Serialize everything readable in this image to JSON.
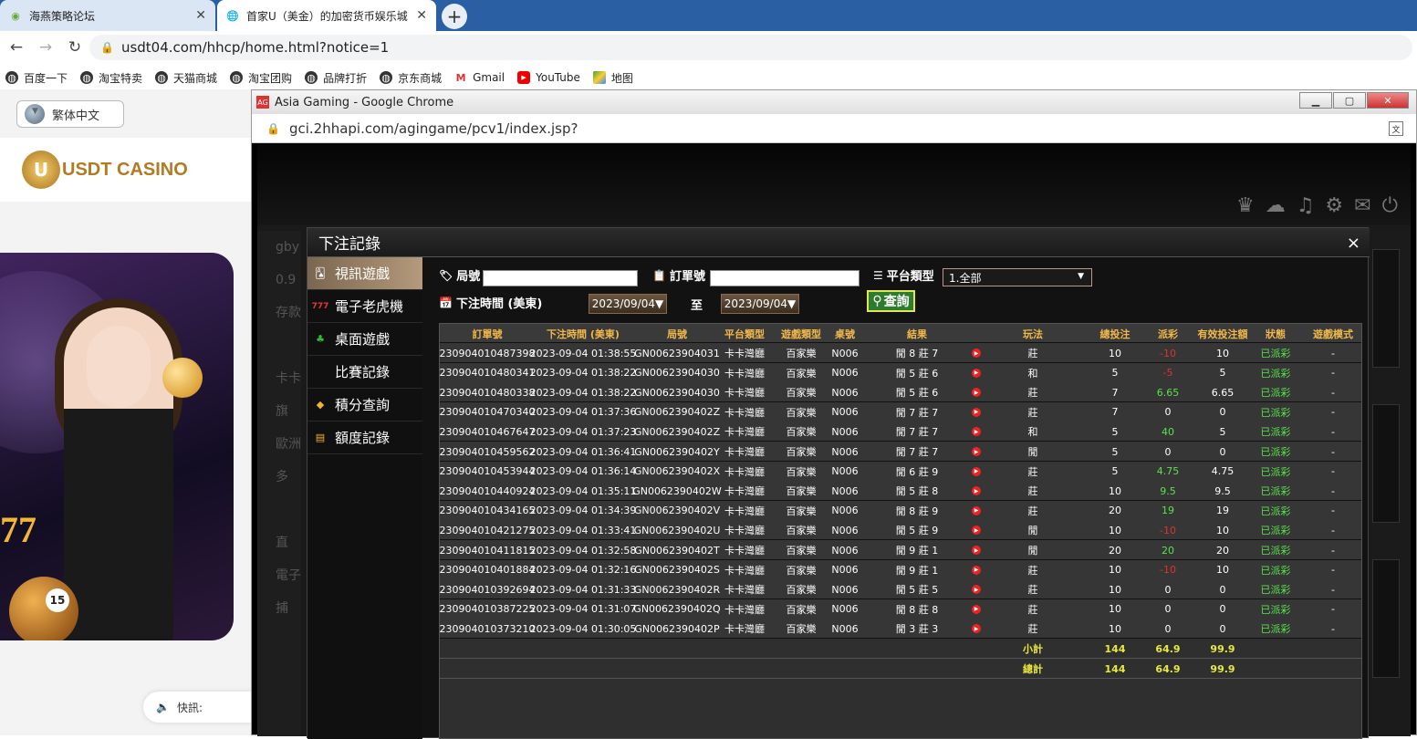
{
  "browser": {
    "tabs": [
      {
        "title": "海燕策略论坛"
      },
      {
        "title": "首家U（美金）的加密货币娱乐城"
      }
    ],
    "address": "usdt04.com/hhcp/home.html?notice=1",
    "bookmarks": [
      {
        "label": "百度一下",
        "icon": "globe-icon"
      },
      {
        "label": "淘宝特卖",
        "icon": "globe-icon"
      },
      {
        "label": "天猫商城",
        "icon": "globe-icon"
      },
      {
        "label": "淘宝团购",
        "icon": "globe-icon"
      },
      {
        "label": "品牌打折",
        "icon": "globe-icon"
      },
      {
        "label": "京东商城",
        "icon": "globe-icon"
      },
      {
        "label": "Gmail",
        "icon": "gmail-icon"
      },
      {
        "label": "YouTube",
        "icon": "youtube-icon"
      },
      {
        "label": "地图",
        "icon": "maps-icon"
      }
    ]
  },
  "site": {
    "language": "繁体中文",
    "logo_text": "USDT CASINO",
    "logo_letter": "U",
    "banner_number": "15",
    "banner_slot": "77",
    "chat_label": "快訊:"
  },
  "popup": {
    "title": "Asia Gaming - Google Chrome",
    "address": "gci.2hhapi.com/agingame/pcv1/index.jsp?"
  },
  "game": {
    "left_strip": [
      "gby",
      "0.9",
      "存款",
      "",
      "卡卡",
      "旗",
      "歐洲",
      "多",
      "",
      "直",
      "電子",
      "捕"
    ]
  },
  "modal": {
    "title": "下注記錄",
    "close": "×",
    "menu": [
      {
        "label": "視訊遊戲",
        "icon": "cards-icon",
        "active": true
      },
      {
        "label": "電子老虎機",
        "icon": "slot-777-icon",
        "active": false
      },
      {
        "label": "桌面遊戲",
        "icon": "table-game-icon",
        "active": false
      },
      {
        "label": "比賽記錄",
        "icon": "",
        "active": false
      },
      {
        "label": "積分查詢",
        "icon": "diamond-icon",
        "active": false
      },
      {
        "label": "額度記錄",
        "icon": "document-icon",
        "active": false
      }
    ],
    "filters": {
      "round_label": "局號",
      "order_label": "訂單號",
      "platform_label": "平台類型",
      "platform_value": "1.全部",
      "time_label": "下注時間 (美東)",
      "date_from": "2023/09/04▼",
      "to_label": "至",
      "date_to": "2023/09/04▼",
      "query_label": "查詢"
    },
    "table": {
      "headers": [
        "訂單號",
        "下注時間 (美東)",
        "局號",
        "平台類型",
        "遊戲類型",
        "桌號",
        "結果",
        "",
        "玩法",
        "總投注",
        "派彩",
        "有效投注額",
        "狀態",
        "遊戲模式"
      ],
      "rows": [
        [
          "230904010487398",
          "2023-09-04 01:38:55",
          "GN00623904031",
          "卡卡灣廳",
          "百家樂",
          "N006",
          "閒 8 莊 7",
          "莊",
          "10",
          "-10",
          "10",
          "已派彩",
          "-"
        ],
        [
          "230904010480341",
          "2023-09-04 01:38:22",
          "GN00623904030",
          "卡卡灣廳",
          "百家樂",
          "N006",
          "閒 5 莊 6",
          "和",
          "5",
          "-5",
          "5",
          "已派彩",
          "-"
        ],
        [
          "230904010480338",
          "2023-09-04 01:38:22",
          "GN00623904030",
          "卡卡灣廳",
          "百家樂",
          "N006",
          "閒 5 莊 6",
          "莊",
          "7",
          "6.65",
          "6.65",
          "已派彩",
          "-"
        ],
        [
          "230904010470340",
          "2023-09-04 01:37:36",
          "GN0062390402Z",
          "卡卡灣廳",
          "百家樂",
          "N006",
          "閒 7 莊 7",
          "莊",
          "7",
          "0",
          "0",
          "已派彩",
          "-"
        ],
        [
          "230904010467647",
          "2023-09-04 01:37:23",
          "GN0062390402Z",
          "卡卡灣廳",
          "百家樂",
          "N006",
          "閒 7 莊 7",
          "和",
          "5",
          "40",
          "5",
          "已派彩",
          "-"
        ],
        [
          "230904010459562",
          "2023-09-04 01:36:41",
          "GN0062390402Y",
          "卡卡灣廳",
          "百家樂",
          "N006",
          "閒 7 莊 7",
          "閒",
          "5",
          "0",
          "0",
          "已派彩",
          "-"
        ],
        [
          "230904010453944",
          "2023-09-04 01:36:14",
          "GN0062390402X",
          "卡卡灣廳",
          "百家樂",
          "N006",
          "閒 6 莊 9",
          "莊",
          "5",
          "4.75",
          "4.75",
          "已派彩",
          "-"
        ],
        [
          "230904010440924",
          "2023-09-04 01:35:11",
          "GN0062390402W",
          "卡卡灣廳",
          "百家樂",
          "N006",
          "閒 5 莊 8",
          "莊",
          "10",
          "9.5",
          "9.5",
          "已派彩",
          "-"
        ],
        [
          "230904010434165",
          "2023-09-04 01:34:39",
          "GN0062390402V",
          "卡卡灣廳",
          "百家樂",
          "N006",
          "閒 8 莊 9",
          "莊",
          "20",
          "19",
          "19",
          "已派彩",
          "-"
        ],
        [
          "230904010421275",
          "2023-09-04 01:33:41",
          "GN0062390402U",
          "卡卡灣廳",
          "百家樂",
          "N006",
          "閒 5 莊 9",
          "閒",
          "10",
          "-10",
          "10",
          "已派彩",
          "-"
        ],
        [
          "230904010411815",
          "2023-09-04 01:32:58",
          "GN0062390402T",
          "卡卡灣廳",
          "百家樂",
          "N006",
          "閒 9 莊 1",
          "閒",
          "20",
          "20",
          "20",
          "已派彩",
          "-"
        ],
        [
          "230904010401884",
          "2023-09-04 01:32:16",
          "GN0062390402S",
          "卡卡灣廳",
          "百家樂",
          "N006",
          "閒 9 莊 1",
          "莊",
          "10",
          "-10",
          "10",
          "已派彩",
          "-"
        ],
        [
          "230904010392694",
          "2023-09-04 01:31:33",
          "GN0062390402R",
          "卡卡灣廳",
          "百家樂",
          "N006",
          "閒 5 莊 5",
          "莊",
          "10",
          "0",
          "0",
          "已派彩",
          "-"
        ],
        [
          "230904010387225",
          "2023-09-04 01:31:07",
          "GN0062390402Q",
          "卡卡灣廳",
          "百家樂",
          "N006",
          "閒 8 莊 8",
          "莊",
          "10",
          "0",
          "0",
          "已派彩",
          "-"
        ],
        [
          "230904010373210",
          "2023-09-04 01:30:05",
          "GN0062390402P",
          "卡卡灣廳",
          "百家樂",
          "N006",
          "閒 3 莊 3",
          "莊",
          "10",
          "0",
          "0",
          "已派彩",
          "-"
        ]
      ],
      "subtotal": {
        "label": "小計",
        "bet": "144",
        "payout": "64.9",
        "valid": "99.9"
      },
      "total": {
        "label": "總計",
        "bet": "144",
        "payout": "64.9",
        "valid": "99.9"
      }
    }
  }
}
